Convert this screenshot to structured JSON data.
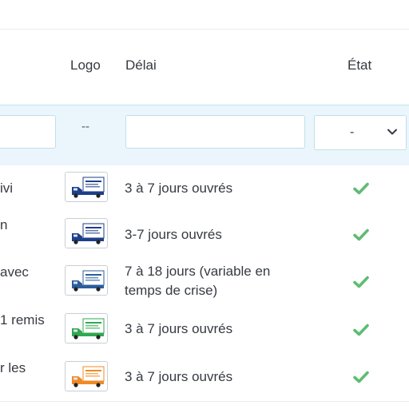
{
  "table": {
    "headers": {
      "logo": "Logo",
      "delay": "Délai",
      "state": "État"
    },
    "filters": {
      "logo_placeholder": "--",
      "state_select_value": "-"
    },
    "rows": [
      {
        "name_fragment": "ivi",
        "delay_line1": "3 à 7 jours ouvrés",
        "delay_line2": "",
        "truck_color": "#1e3f8a",
        "sign_color": "#1e3f8a",
        "enabled": true
      },
      {
        "name_fragment": "n",
        "delay_line1": "3-7 jours ouvrés",
        "delay_line2": "",
        "truck_color": "#1e3f8a",
        "sign_color": "#1e3f8a",
        "enabled": true
      },
      {
        "name_fragment": "avec",
        "delay_line1": "7 à 18 jours (variable en",
        "delay_line2": "temps de crise)",
        "truck_color": "#2b5d9c",
        "sign_color": "#2b5d9c",
        "enabled": true
      },
      {
        "name_fragment": "1 remis",
        "delay_line1": "3 à 7 jours ouvrés",
        "delay_line2": "",
        "truck_color": "#2fa84f",
        "sign_color": "#2fa84f",
        "enabled": true
      },
      {
        "name_fragment": "r les",
        "delay_line1": "3 à 7 jours ouvrés",
        "delay_line2": "",
        "truck_color": "#f08a24",
        "sign_color": "#f08a24",
        "enabled": true
      }
    ]
  },
  "colors": {
    "check": "#5fbc73",
    "filter_bg": "#eaf6fc",
    "border": "#e9edf1"
  }
}
